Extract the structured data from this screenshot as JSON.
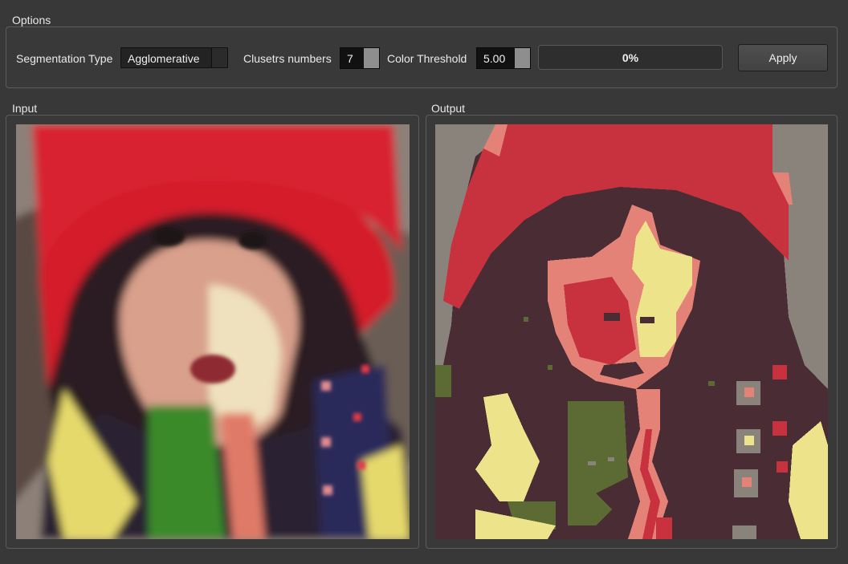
{
  "options": {
    "title": "Options",
    "segmentation_type_label": "Segmentation Type",
    "segmentation_type_value": "Agglomerative",
    "clusters_label": "Clusetrs numbers",
    "clusters_value": "7",
    "threshold_label": "Color Threshold",
    "threshold_value": "5.00",
    "progress_text": "0%",
    "progress_fraction": 0,
    "apply_label": "Apply"
  },
  "input": {
    "title": "Input"
  },
  "output": {
    "title": "Output"
  },
  "colors": {
    "background": "#383838",
    "hat_red": "#d6212f",
    "seg_red": "#c8323e",
    "seg_salmon": "#e48278",
    "seg_cream": "#ece38a",
    "seg_olive": "#5c6a34",
    "seg_maroon": "#4a2d34",
    "seg_gray": "#8a837c"
  }
}
